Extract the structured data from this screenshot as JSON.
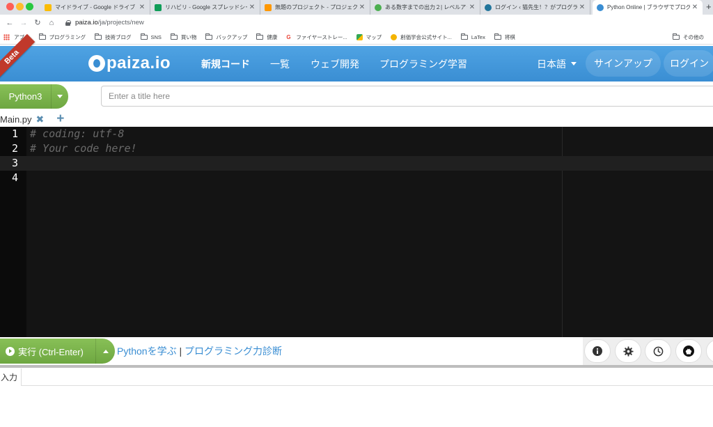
{
  "browser": {
    "tabs": [
      {
        "title": "マイドライブ - Google ドライブ",
        "color": "#fbbc04"
      },
      {
        "title": "リハビリ - Google スプレッドシー",
        "color": "#0f9d58"
      },
      {
        "title": "無題のプロジェクト - プロジェク",
        "color": "#ff9800"
      },
      {
        "title": "ある数字までの出力２| レベルアッ",
        "color": "#4caf50"
      },
      {
        "title": "ログイン ‹ 猫先生！？がプログラミ",
        "color": "#21759b"
      },
      {
        "title": "Python Online | ブラウザでプログ",
        "color": "#3a8ed3"
      }
    ],
    "address": {
      "host": "paiza.io",
      "path": "/ja/projects/new"
    },
    "bookmarks": [
      {
        "label": "アプリ",
        "icon": "apps-icon"
      },
      {
        "label": "プログラミング",
        "icon": "folder-icon"
      },
      {
        "label": "技術ブログ",
        "icon": "folder-icon"
      },
      {
        "label": "SNS",
        "icon": "folder-icon"
      },
      {
        "label": "買い物",
        "icon": "folder-icon"
      },
      {
        "label": "バックアップ",
        "icon": "folder-icon"
      },
      {
        "label": "健康",
        "icon": "folder-icon"
      },
      {
        "label": "ファイヤーストレー...",
        "icon": "google-icon"
      },
      {
        "label": "マップ",
        "icon": "maps-icon"
      },
      {
        "label": "創価学会公式サイト...",
        "icon": "site-icon"
      },
      {
        "label": "LaTex",
        "icon": "folder-icon"
      },
      {
        "label": "将棋",
        "icon": "folder-icon"
      }
    ],
    "other_bookmarks": "その他の"
  },
  "header": {
    "ribbon": "Beta",
    "logo": "paiza.io",
    "nav": {
      "new_code": "新規コード",
      "list": "一覧",
      "web_dev": "ウェブ開発",
      "learn": "プログラミング学習"
    },
    "language": "日本語",
    "signup": "サインアップ",
    "login": "ログイン"
  },
  "project": {
    "language": "Python3",
    "title_placeholder": "Enter a title here"
  },
  "files": {
    "tabs": [
      {
        "name": "Main.py"
      }
    ]
  },
  "editor": {
    "lines": [
      {
        "num": "1",
        "text": "# coding: utf-8"
      },
      {
        "num": "2",
        "text": "# Your code here!"
      },
      {
        "num": "3",
        "text": ""
      },
      {
        "num": "4",
        "text": ""
      }
    ],
    "active_line": 3
  },
  "runbar": {
    "run_label": "実行 (Ctrl-Enter)",
    "learn_python": "Pythonを学ぶ",
    "separator": "|",
    "diagnose": "プログラミング力診断"
  },
  "io": {
    "input_label": "入力"
  },
  "colors": {
    "header_blue": "#3a8ed3",
    "accent_green": "#6ea741",
    "editor_bg": "#141414",
    "link_blue": "#3a8ed3"
  }
}
